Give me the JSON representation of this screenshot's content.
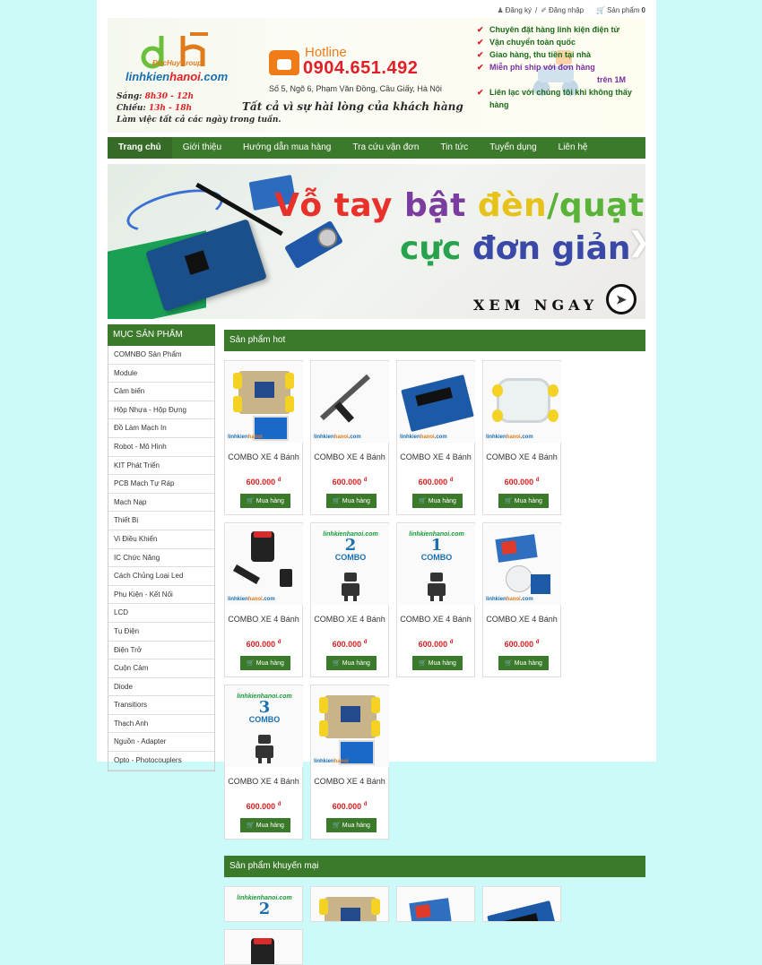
{
  "topbar": {
    "register": "Đăng ký",
    "separator": "/",
    "login": "Đăng nhập",
    "cart_label": "Sản phẩm",
    "cart_count": "0"
  },
  "header": {
    "logo_group": "ĐứcHuyGroup",
    "logo_site_a": "linhkien",
    "logo_site_b": "hanoi",
    "logo_site_c": ".com",
    "hours_morning_label": "Sáng: ",
    "hours_morning": "8h30 - 12h",
    "hours_afternoon_label": "Chiều: ",
    "hours_afternoon": "13h - 18h",
    "hours_note": "Làm việc tất cả các ngày trong tuần.",
    "hotline_label": "Hotline",
    "hotline_number": "0904.651.492",
    "address": "Số 5, Ngõ 6, Phạm Văn Đồng, Cầu Giấy, Hà Nội",
    "slogan": "Tất cả vì sự hài lòng của khách hàng",
    "benefits": [
      "Chuyên đặt hàng linh kiện điện tử",
      "Vận chuyển toàn quốc",
      "Giao hàng, thu tiền tại nhà",
      "Miễn phí ship với đơn hàng",
      "trên 1M",
      "Liên lạc với chúng tôi khi không thấy hàng"
    ]
  },
  "nav": [
    "Trang chủ",
    "Giới thiệu",
    "Hướng dẫn mua hàng",
    "Tra cứu vận đơn",
    "Tin tức",
    "Tuyển dụng",
    "Liên hệ"
  ],
  "slider": {
    "line1_a": "Vỗ tay ",
    "line1_b": "bật ",
    "line1_c": "đèn",
    "line1_d": "/quạt",
    "line2_a": "cực ",
    "line2_b": "đơn giản",
    "cta": "XEM NGAY",
    "colors": {
      "red": "#e8312b",
      "yellow": "#e6c21b",
      "purple": "#7a3c9e",
      "green": "#59b338",
      "blue": "#3a49a8"
    }
  },
  "sidebar": {
    "title": "MỤC SẢN PHẨM",
    "items": [
      "COMNBO Sản Phẩm",
      "Module",
      "Cảm biến",
      "Hộp Nhựa - Hộp Đựng",
      "Đồ Làm Mạch In",
      "Robot - Mô Hình",
      "KIT Phát Triển",
      "PCB Mạch Tự Ráp",
      "Mạch Nạp",
      "Thiết Bị",
      "Vi Điều Khiển",
      "IC Chức Năng",
      "Cách Chủng Loại Led",
      "Phụ Kiện - Kết Nối",
      "LCD",
      "Tụ Điện",
      "Điện Trở",
      "Cuộn Cảm",
      "Diode",
      "Transitiors",
      "Thạch Anh",
      "Nguồn - Adapter",
      "Opto - Photocouplers"
    ]
  },
  "hot": {
    "title": "Sản phẩm hot",
    "products": [
      {
        "name": "COMBO XE 4 Bánh",
        "price": "600.000",
        "currency": "đ",
        "buy": "Mua hàng",
        "image": "robot-car"
      },
      {
        "name": "COMBO XE 4 Bánh",
        "price": "600.000",
        "currency": "đ",
        "buy": "Mua hàng",
        "image": "soldering-iron"
      },
      {
        "name": "COMBO XE 4 Bánh",
        "price": "600.000",
        "currency": "đ",
        "buy": "Mua hàng",
        "image": "motor-driver-board"
      },
      {
        "name": "COMBO XE 4 Bánh",
        "price": "600.000",
        "currency": "đ",
        "buy": "Mua hàng",
        "image": "acrylic-chassis"
      },
      {
        "name": "COMBO XE 4 Bánh",
        "price": "600.000",
        "currency": "đ",
        "buy": "Mua hàng",
        "image": "speaker-adapter"
      },
      {
        "name": "COMBO XE 4 Bánh",
        "price": "600.000",
        "currency": "đ",
        "buy": "Mua hàng",
        "image": "combo-2",
        "combo_num": "2",
        "combo_label": "COMBO",
        "combo_site": "linhkienhanoi.com"
      },
      {
        "name": "COMBO XE 4 Bánh",
        "price": "600.000",
        "currency": "đ",
        "buy": "Mua hàng",
        "image": "combo-1",
        "combo_num": "1",
        "combo_label": "COMBO",
        "combo_site": "linhkienhanoi.com"
      },
      {
        "name": "COMBO XE 4 Bánh",
        "price": "600.000",
        "currency": "đ",
        "buy": "Mua hàng",
        "image": "relay-pir"
      },
      {
        "name": "COMBO XE 4 Bánh",
        "price": "600.000",
        "currency": "đ",
        "buy": "Mua hàng",
        "image": "combo-3",
        "combo_num": "3",
        "combo_label": "COMBO",
        "combo_site": "linhkienhanoi.com"
      },
      {
        "name": "COMBO XE 4 Bánh",
        "price": "600.000",
        "currency": "đ",
        "buy": "Mua hàng",
        "image": "robot-car"
      }
    ]
  },
  "promo": {
    "title": "Sản phẩm khuyến mại",
    "visible_number": "2"
  },
  "watermark": {
    "a": "linhkien",
    "b": "hanoi",
    "c": ".com"
  }
}
